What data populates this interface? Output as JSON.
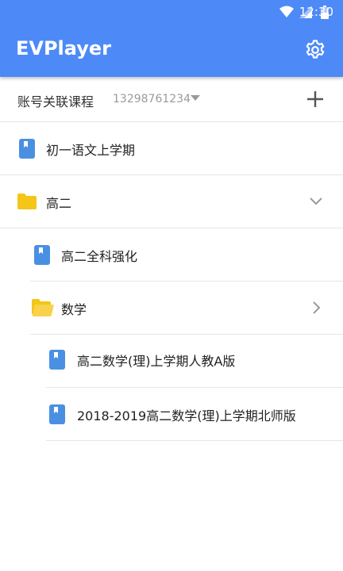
{
  "status_bar": {
    "time": "12:30"
  },
  "app_bar": {
    "title": "EVPlayer"
  },
  "account": {
    "label": "账号关联课程",
    "number": "13298761234"
  },
  "tree": {
    "item1": {
      "label": "初一语文上学期"
    },
    "folder1": {
      "label": "高二"
    },
    "item2": {
      "label": "高二全科强化"
    },
    "folder2": {
      "label": "数学"
    },
    "item3": {
      "label": "高二数学(理)上学期人教A版"
    },
    "item4": {
      "label": "2018-2019高二数学(理)上学期北师版"
    }
  },
  "colors": {
    "primary": "#4d8af7",
    "book_icon": "#4a90e2",
    "folder_icon": "#f5c518",
    "divider": "#e6e6e6"
  }
}
